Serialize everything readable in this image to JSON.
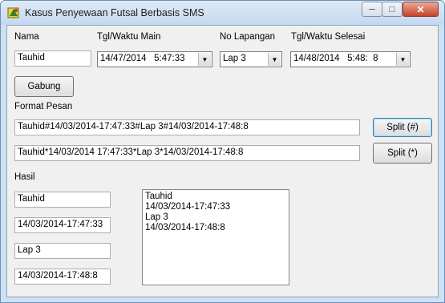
{
  "window": {
    "title": "Kasus Penyewaan Futsal Berbasis SMS",
    "min_glyph": "─",
    "max_glyph": "□",
    "close_glyph": "✕",
    "icon": "app-icon"
  },
  "form": {
    "nama": {
      "label": "Nama",
      "value": "Tauhid"
    },
    "tgl_main": {
      "label": "Tgl/Waktu Main",
      "value": "14/47/2014   5:47:33"
    },
    "lapangan": {
      "label": "No Lapangan",
      "value": "Lap 3"
    },
    "tgl_selesai": {
      "label": "Tgl/Waktu Selesai",
      "value": "14/48/2014   5:48:  8"
    },
    "gabung_label": "Gabung",
    "dropdown_glyph": "▼"
  },
  "format": {
    "label": "Format Pesan",
    "pesan1": "Tauhid#14/03/2014-17:47:33#Lap 3#14/03/2014-17:48:8",
    "pesan2": "Tauhid*14/03/2014 17:47:33*Lap 3*14/03/2014-17:48:8",
    "split_hash_label": "Split (#)",
    "split_star_label": "Split (*)"
  },
  "hasil": {
    "label": "Hasil",
    "fields": [
      "Tauhid",
      "14/03/2014-17:47:33",
      "Lap 3",
      "14/03/2014-17:48:8"
    ],
    "list_items": [
      "Tauhid",
      "14/03/2014-17:47:33",
      "Lap 3",
      "14/03/2014-17:48:8"
    ]
  }
}
